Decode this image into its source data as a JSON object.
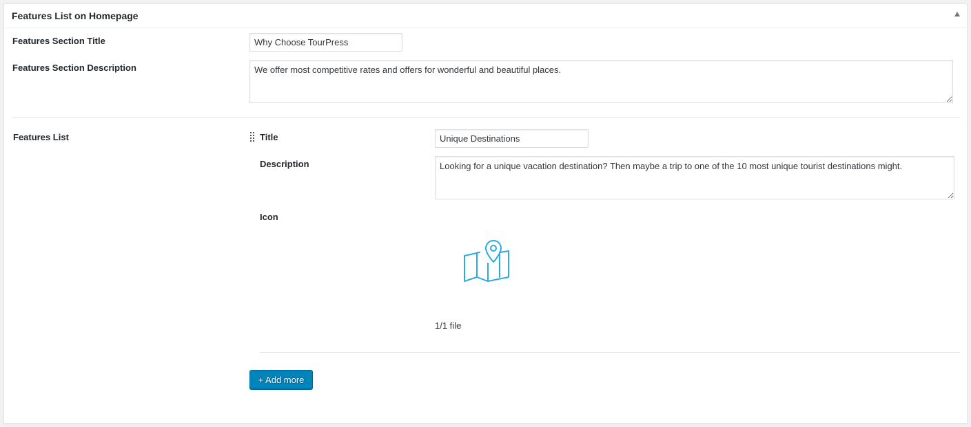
{
  "metabox": {
    "title": "Features List on Homepage",
    "toggle_icon": "triangle-up-icon"
  },
  "section": {
    "title_label": "Features Section Title",
    "title_value": "Why Choose TourPress",
    "description_label": "Features Section Description",
    "description_value": "We offer most competitive rates and offers for wonderful and beautiful places."
  },
  "features_list": {
    "label": "Features List",
    "items": [
      {
        "title_label": "Title",
        "title_value": "Unique Destinations",
        "description_label": "Description",
        "description_value": "Looking for a unique vacation destination? Then maybe a trip to one of the 10 most unique tourist destinations might.",
        "icon_label": "Icon",
        "icon_image": "map-pin-icon",
        "file_count": "1/1 file"
      }
    ],
    "add_more_label": "+ Add more"
  },
  "colors": {
    "icon": "#29abe2",
    "button": "#0085ba"
  }
}
